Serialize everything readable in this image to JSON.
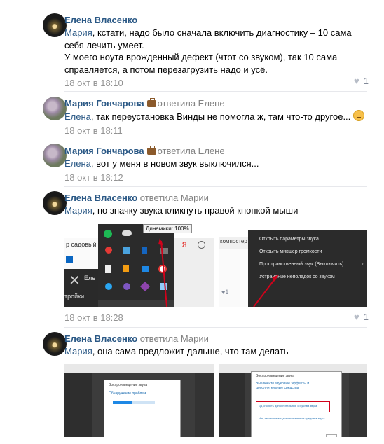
{
  "comments": [
    {
      "author": "Елена Власенко",
      "replied_to": "",
      "mention": "Мария",
      "text_after_mention": ", кстати, надо было сначала включить диагностику – 10 сама себя лечить умеет.",
      "text_line2": "У моего ноута врожденный дефект (чтот со звуком), так 10 сама справляется, а потом перезагрузить надо и усё.",
      "date": "18 окт в 18:10",
      "likes": "1"
    },
    {
      "author": "Мария Гончарова",
      "replied_to": "ответила Елене",
      "mention": "Елена",
      "text_after_mention": ", так переустановка Винды не помогла ж, там что-то другое...",
      "date": "18 окт в 18:11"
    },
    {
      "author": "Мария Гончарова",
      "replied_to": "ответила Елене",
      "mention": "Елена",
      "text_after_mention": ", вот у меня в новом звук выключился...",
      "date": "18 окт в 18:12"
    },
    {
      "author": "Елена Власенко",
      "replied_to": "ответила Марии",
      "mention": "Мария",
      "text_after_mention": ", по значку звука кликнуть правой кнопкой мыши",
      "date": "18 окт в 18:28",
      "likes": "1",
      "screenshot1": {
        "tooltip": "Динамики: 100%",
        "left_text": "р садовый",
        "bottom_text": "тройки",
        "side_text": "Еле"
      },
      "screenshot2": {
        "top_text": "компостер сад",
        "menu": [
          "Открыть параметры звука",
          "Открыть микшер громкости",
          "Пространственный звук (Выключить)",
          "Устранение неполадок со звуком"
        ]
      }
    },
    {
      "author": "Елена Власенко",
      "replied_to": "ответила Марии",
      "mention": "Мария",
      "text_after_mention": ", она сама предложит дальше, что там делать",
      "screenshot3": {
        "dialog_title": "Воспроизведение звука",
        "status": "Обнаружение проблем"
      },
      "screenshot4": {
        "dialog_title": "Воспроизведение звука",
        "heading": "Выключите звуковые эффекты и дополнительные средства",
        "option": "Да, открыть дополнительные средства звука",
        "option2": "Нет, не открывать дополнительные средства звука"
      }
    }
  ],
  "colors": {
    "link": "#2a5885",
    "meta": "#939393",
    "divider": "#e7e8ec",
    "arrow": "#d0021b"
  },
  "icons": [
    "heart-icon",
    "briefcase-icon",
    "worried-face-emoji"
  ]
}
